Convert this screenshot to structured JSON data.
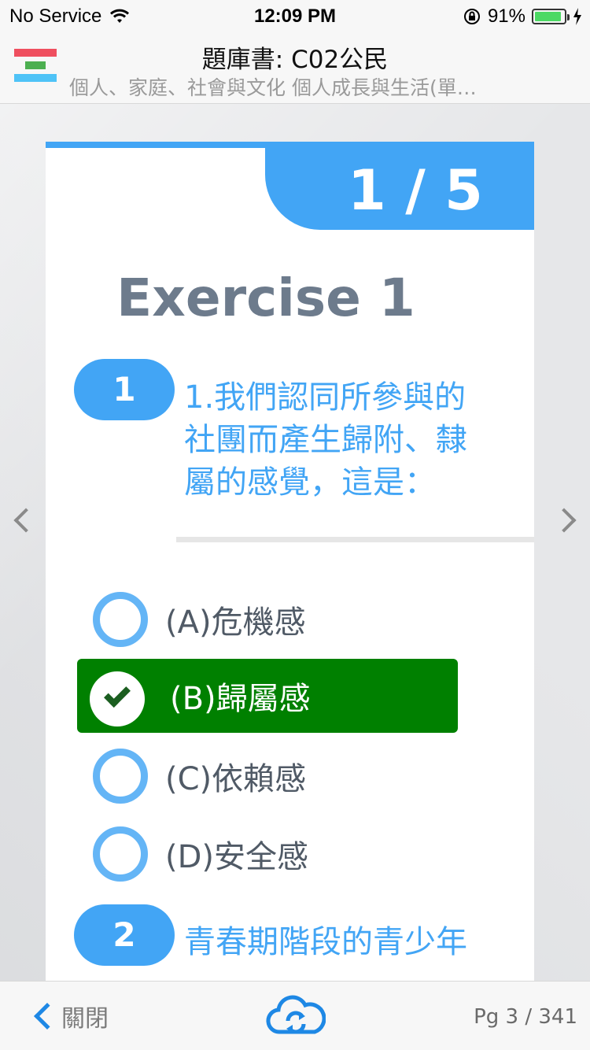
{
  "status_bar": {
    "carrier": "No Service",
    "time": "12:09 PM",
    "battery": "91%",
    "battery_level": 0.91
  },
  "header": {
    "title": "題庫書: C02公民",
    "subtitle": "個人、家庭、社會與文化 個人成長與生活(單…",
    "menu_colors": [
      "#ef4f5f",
      "#4caf50",
      "#4fc3f7"
    ]
  },
  "card": {
    "counter": "1 / 5",
    "exercise_title": "Exercise 1",
    "accent_color": "#42a5f5",
    "questions": [
      {
        "number": "1",
        "lines": [
          "1.我們認同所參與的",
          "社團而產生歸附、隸",
          "屬的感覺，這是："
        ],
        "options": [
          {
            "label": "(A)危機感",
            "selected": false
          },
          {
            "label": "(B)歸屬感",
            "selected": true
          },
          {
            "label": "(C)依賴感",
            "selected": false
          },
          {
            "label": "(D)安全感",
            "selected": false
          }
        ]
      },
      {
        "number": "2",
        "lines": [
          "青春期階段的青少年"
        ]
      }
    ],
    "selected_color": "#008000"
  },
  "toolbar": {
    "back_label": "關閉",
    "page_indicator": "Pg 3 / 341",
    "sync_icon": "cloud-sync-icon"
  }
}
